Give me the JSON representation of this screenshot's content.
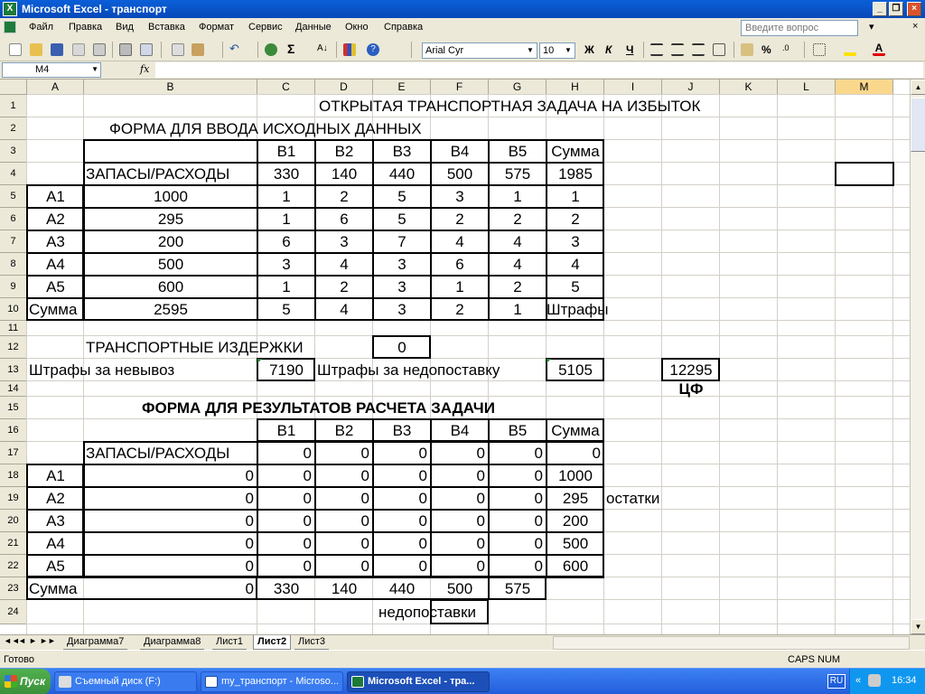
{
  "window": {
    "title": "Microsoft Excel - транспорт",
    "app_icon": "excel-icon",
    "controls": [
      "_",
      "❐",
      "×"
    ]
  },
  "menu": {
    "items": [
      "Файл",
      "Правка",
      "Вид",
      "Вставка",
      "Формат",
      "Сервис",
      "Данные",
      "Окно",
      "Справка"
    ],
    "ask_placeholder": "Введите вопрос",
    "close_glyph": "×"
  },
  "toolbar": {
    "font": "Arial Cyr",
    "size": "10",
    "bold": "Ж",
    "italic": "К",
    "underline": "Ч",
    "percent": "%"
  },
  "formula_bar": {
    "name_box": "M4",
    "fx": "fx",
    "content": ""
  },
  "sheet": {
    "columns": [
      "A",
      "B",
      "C",
      "D",
      "E",
      "F",
      "G",
      "H",
      "I",
      "J",
      "K",
      "L",
      "M"
    ],
    "selected_column": "M",
    "selected_cell": "M4",
    "rows": [
      "1",
      "2",
      "3",
      "4",
      "5",
      "6",
      "7",
      "8",
      "9",
      "10",
      "11",
      "12",
      "13",
      "14",
      "15",
      "16",
      "17",
      "18",
      "19",
      "20",
      "21",
      "22",
      "23",
      "24"
    ],
    "texts": {
      "title": "ОТКРЫТАЯ ТРАНСПОРТНАЯ ЗАДАЧА НА ИЗБЫТОК",
      "input_form": "ФОРМА ДЛЯ ВВОДА ИСХОДНЫХ ДАННЫХ",
      "transport_costs": "ТРАНСПОРТНЫЕ ИЗДЕРЖКИ",
      "transport_costs_value": "0",
      "fines_export_label": "Штрафы за невывоз",
      "fines_export_value": "7190",
      "fines_supply_label": "Штрафы за недопоставку",
      "fines_supply_value": "5105",
      "objective_value": "12295",
      "objective_label": "ЦФ",
      "results_form": "ФОРМА ДЛЯ РЕЗУЛЬТАТОВ РАСЧЕТА ЗАДАЧИ",
      "remainders": "остатки",
      "shortages": "недопоставки"
    },
    "input_table": {
      "header": [
        "",
        "",
        "В1",
        "В2",
        "В3",
        "В4",
        "В5",
        "Сумма"
      ],
      "rows": [
        [
          "",
          "ЗАПАСЫ/РАСХОДЫ",
          "330",
          "140",
          "440",
          "500",
          "575",
          "1985"
        ],
        [
          "А1",
          "1000",
          "1",
          "2",
          "5",
          "3",
          "1",
          "1"
        ],
        [
          "А2",
          "295",
          "1",
          "6",
          "5",
          "2",
          "2",
          "2"
        ],
        [
          "А3",
          "200",
          "6",
          "3",
          "7",
          "4",
          "4",
          "3"
        ],
        [
          "А4",
          "500",
          "3",
          "4",
          "3",
          "6",
          "4",
          "4"
        ],
        [
          "А5",
          "600",
          "1",
          "2",
          "3",
          "1",
          "2",
          "5"
        ],
        [
          "Сумма",
          "2595",
          "5",
          "4",
          "3",
          "2",
          "1",
          "Штрафы"
        ]
      ]
    },
    "result_table": {
      "header": [
        "",
        "",
        "В1",
        "В2",
        "В3",
        "В4",
        "В5",
        "Сумма"
      ],
      "rows": [
        [
          "",
          "ЗАПАСЫ/РАСХОДЫ",
          "0",
          "0",
          "0",
          "0",
          "0",
          "0"
        ],
        [
          "А1",
          "0",
          "0",
          "0",
          "0",
          "0",
          "0",
          "1000"
        ],
        [
          "А2",
          "0",
          "0",
          "0",
          "0",
          "0",
          "0",
          "295"
        ],
        [
          "А3",
          "0",
          "0",
          "0",
          "0",
          "0",
          "0",
          "200"
        ],
        [
          "А4",
          "0",
          "0",
          "0",
          "0",
          "0",
          "0",
          "500"
        ],
        [
          "А5",
          "0",
          "0",
          "0",
          "0",
          "0",
          "0",
          "600"
        ],
        [
          "Сумма",
          "0",
          "330",
          "140",
          "440",
          "500",
          "575",
          ""
        ]
      ]
    }
  },
  "tabs": {
    "nav": [
      "◄◄",
      "◄",
      "►",
      "►►"
    ],
    "items": [
      "Диаграмма7",
      "Диаграмма8",
      "Лист1",
      "Лист2",
      "Лист3"
    ],
    "active": "Лист2"
  },
  "status": {
    "left": "Готово",
    "right": "CAPS NUM"
  },
  "taskbar": {
    "start": "Пуск",
    "tasks": [
      "Съемный диск (F:)",
      "my_транспорт - Microso...",
      "Microsoft Excel - тра..."
    ],
    "lang": "RU",
    "time": "16:34",
    "collapse": "«"
  }
}
